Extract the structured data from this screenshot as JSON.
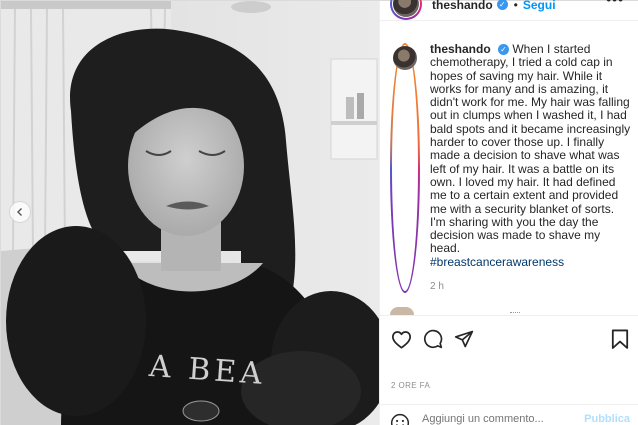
{
  "post": {
    "username": "theshando",
    "verified": true,
    "separator": "•",
    "follow_label": "Segui",
    "more_icon": "more-horizontal-icon",
    "shirt_text": "A BEA",
    "caption": {
      "text": "When I started chemotherapy, I tried a cold cap in hopes of saving my hair. While it works for many and is amazing, it didn't work for me. My hair was falling out in clumps when I washed it, I had bald spots and it became increasingly harder to cover those up. I finally made a decision to shave what was left of my hair. It was a battle on its own. I loved my hair. It had defined me to a certain extent and provided me with a security blanket of sorts. I'm sharing with you the day the decision was made to shave my head.",
      "hashtag": "#breastcancerawareness",
      "time": "2 h"
    },
    "actions": {
      "like_icon": "heart-icon",
      "comment_icon": "comment-bubble-icon",
      "share_icon": "paper-plane-icon",
      "save_icon": "bookmark-icon"
    },
    "date": "2 ORE FA",
    "comment_box": {
      "placeholder": "Aggiungi un commento...",
      "publish_label": "Pubblica",
      "emoji_icon": "emoji-smile-icon"
    }
  },
  "colors": {
    "link": "#0095f6",
    "verified": "#3897f0",
    "hashtag": "#00376b",
    "muted": "#8e8e8e"
  }
}
